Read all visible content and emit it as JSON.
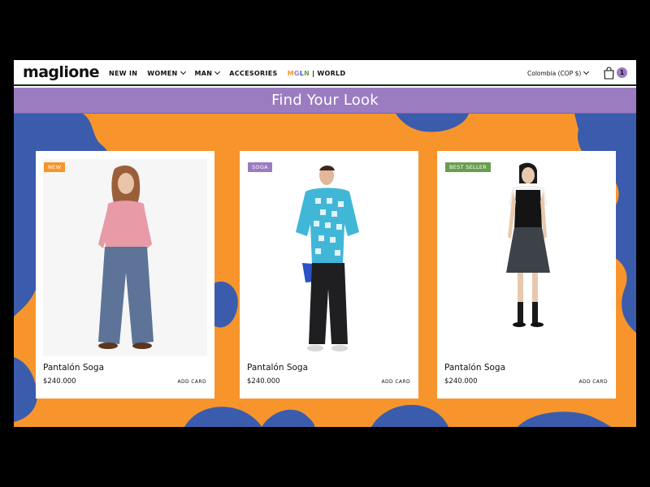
{
  "header": {
    "logo": "maglione",
    "nav": [
      {
        "label": "NEW IN",
        "dropdown": false
      },
      {
        "label": "WOMEN",
        "dropdown": true
      },
      {
        "label": "MAN",
        "dropdown": true
      },
      {
        "label": "ACCESORIES",
        "dropdown": false
      }
    ],
    "mgln": {
      "letters": [
        "M",
        "G",
        "L",
        "N"
      ],
      "colors": [
        "#f7952c",
        "#9b7cc1",
        "#3b5cad",
        "#6a9e4f"
      ],
      "separator": "|",
      "world": "WORLD"
    },
    "country_selector": "Colombia (COP $)",
    "cart_count": "1",
    "cart_icon": "shopping-bag-icon"
  },
  "banner": {
    "title": "Find Your Look",
    "color": "#9b7cc1"
  },
  "background": {
    "orange": "#f7952c",
    "blue": "#3b5cad"
  },
  "products": [
    {
      "badge": "NEW",
      "badge_color": "#f7952c",
      "name": "Pantalón Soga",
      "price": "$240.000",
      "action": "ADD CARD"
    },
    {
      "badge": "SOGA",
      "badge_color": "#9b7cc1",
      "name": "Pantalón Soga",
      "price": "$240.000",
      "action": "ADD CARD"
    },
    {
      "badge": "BEST SELLER",
      "badge_color": "#6a9e4f",
      "name": "Pantalón Soga",
      "price": "$240.000",
      "action": "ADD CARD"
    }
  ]
}
